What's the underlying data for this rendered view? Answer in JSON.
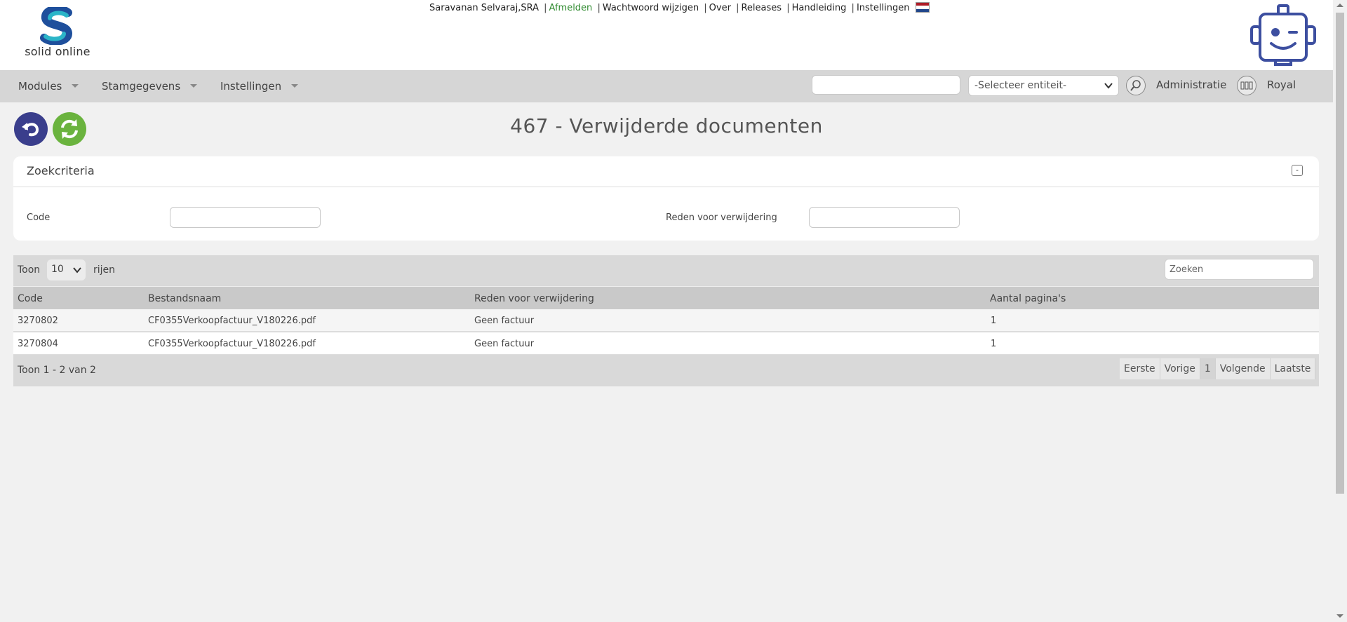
{
  "header": {
    "logo_text": "solid online",
    "user": "Saravanan Selvaraj,SRA",
    "links": [
      "Afmelden",
      "Wachtwoord wijzigen",
      "Over",
      "Releases",
      "Handleiding",
      "Instellingen"
    ],
    "flag_colors": [
      "#ae1c28",
      "#ffffff",
      "#21468b"
    ]
  },
  "nav": {
    "items": [
      "Modules",
      "Stamgegevens",
      "Instellingen"
    ],
    "entity_select": "-Selecteer entiteit-",
    "administratie": "Administratie",
    "company": "Royal"
  },
  "page": {
    "title": "467 - Verwijderde documenten"
  },
  "criteria": {
    "title": "Zoekcriteria",
    "collapse_label": "-",
    "code_label": "Code",
    "code_value": "",
    "reason_label": "Reden voor verwijdering",
    "reason_value": ""
  },
  "table": {
    "show_label": "Toon",
    "page_length": "10",
    "rows_label": "rijen",
    "search_placeholder": "Zoeken",
    "columns": [
      "Code",
      "Bestandsnaam",
      "Reden voor verwijdering",
      "Aantal pagina's"
    ],
    "rows": [
      {
        "code": "3270802",
        "filename": "CF0355Verkoopfactuur_V180226.pdf",
        "reason": "Geen factuur",
        "pages": "1"
      },
      {
        "code": "3270804",
        "filename": "CF0355Verkoopfactuur_V180226.pdf",
        "reason": "Geen factuur",
        "pages": "1"
      }
    ],
    "info": "Toon 1 - 2 van 2",
    "pager": {
      "first": "Eerste",
      "prev": "Vorige",
      "current": "1",
      "next": "Volgende",
      "last": "Laatste"
    }
  },
  "colors": {
    "back_button": "#3a3e8c",
    "refresh_button": "#6ab33e",
    "logo_blue": "#1e4f9c",
    "logo_teal": "#2bb5c8",
    "robot": "#3d4fa0"
  }
}
